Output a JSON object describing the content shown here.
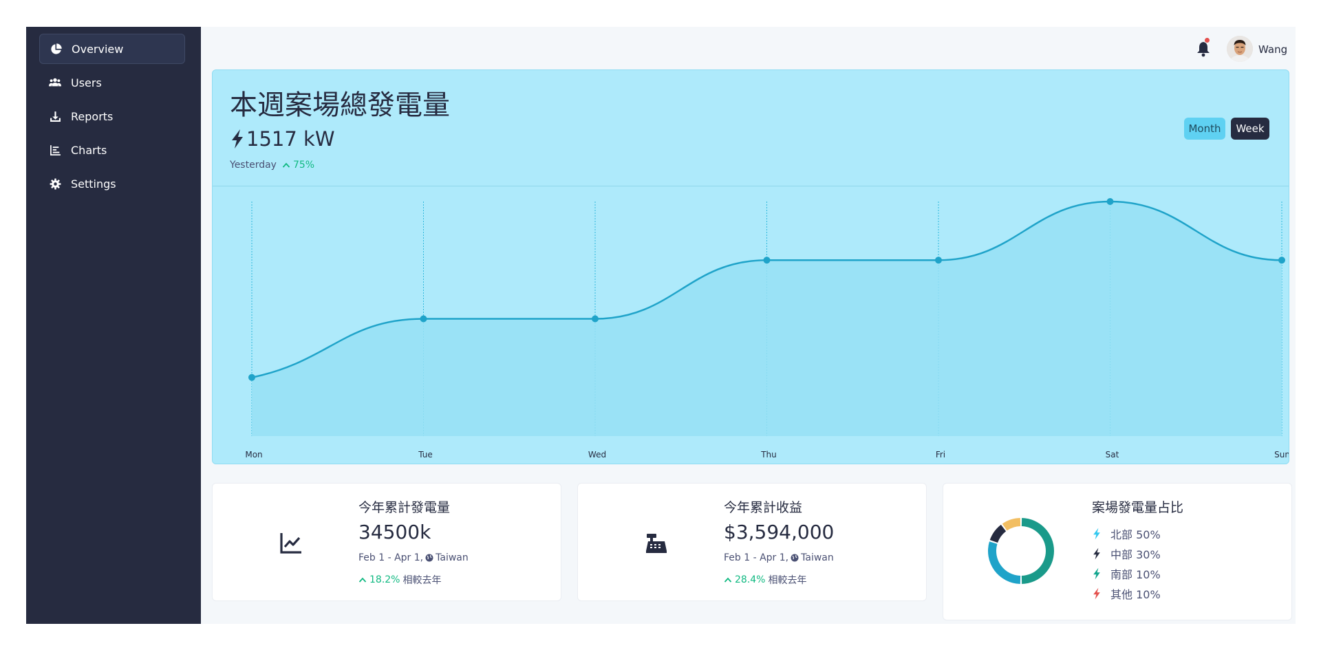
{
  "sidebar": {
    "items": [
      {
        "label": "Overview",
        "icon": "pie-chart-icon",
        "active": true
      },
      {
        "label": "Users",
        "icon": "users-icon",
        "active": false
      },
      {
        "label": "Reports",
        "icon": "download-icon",
        "active": false
      },
      {
        "label": "Charts",
        "icon": "bar-chart-icon",
        "active": false
      },
      {
        "label": "Settings",
        "icon": "gear-icon",
        "active": false
      }
    ]
  },
  "topbar": {
    "username": "Wang",
    "has_notification": true
  },
  "hero": {
    "title": "本週案場總發電量",
    "value": "1517 kW",
    "compare_label": "Yesterday",
    "compare_pct": "75%",
    "buttons": {
      "month": "Month",
      "week": "Week"
    }
  },
  "chart_data": {
    "type": "area",
    "categories": [
      "Mon",
      "Tue",
      "Wed",
      "Thu",
      "Fri",
      "Sat",
      "Sun"
    ],
    "values": [
      1,
      2,
      2,
      3,
      3,
      4,
      3
    ],
    "ylim": [
      0,
      4
    ],
    "grid": "vertical dashed",
    "xlabel": "",
    "ylabel": "",
    "colors": {
      "line": "#1fa3c9",
      "fill": "#97e0f5"
    }
  },
  "cards": [
    {
      "icon": "line-chart-icon",
      "title": "今年累計發電量",
      "value": "34500k",
      "date_range": "Feb 1 - Apr 1,",
      "location": "Taiwan",
      "pct": "18.2%",
      "compare": "相較去年"
    },
    {
      "icon": "cash-register-icon",
      "title": "今年累計收益",
      "value": "$3,594,000",
      "date_range": "Feb 1 - Apr 1,",
      "location": "Taiwan",
      "pct": "28.4%",
      "compare": "相較去年"
    }
  ],
  "share": {
    "title": "案場發電量占比",
    "items": [
      {
        "label": "北部 50%",
        "value": 50,
        "color": "#1fa3c9",
        "bolt_color": "#31c8ef"
      },
      {
        "label": "中部 30%",
        "value": 30,
        "color": "#262b40",
        "bolt_color": "#262b40"
      },
      {
        "label": "南部 10%",
        "value": 10,
        "color": "#1a9a8a",
        "bolt_color": "#10a58e"
      },
      {
        "label": "其他 10%",
        "value": 10,
        "color": "#f2be62",
        "bolt_color": "#e4504d"
      }
    ],
    "donut_segments": [
      {
        "value": 50,
        "color": "#1a9a8a"
      },
      {
        "value": 30,
        "color": "#1fa3c9"
      },
      {
        "value": 10,
        "color": "#262b40"
      },
      {
        "value": 10,
        "color": "#f2be62"
      }
    ]
  },
  "colors": {
    "accent": "#10b981",
    "dark": "#262b40",
    "hero_bg": "#aeeafb"
  }
}
